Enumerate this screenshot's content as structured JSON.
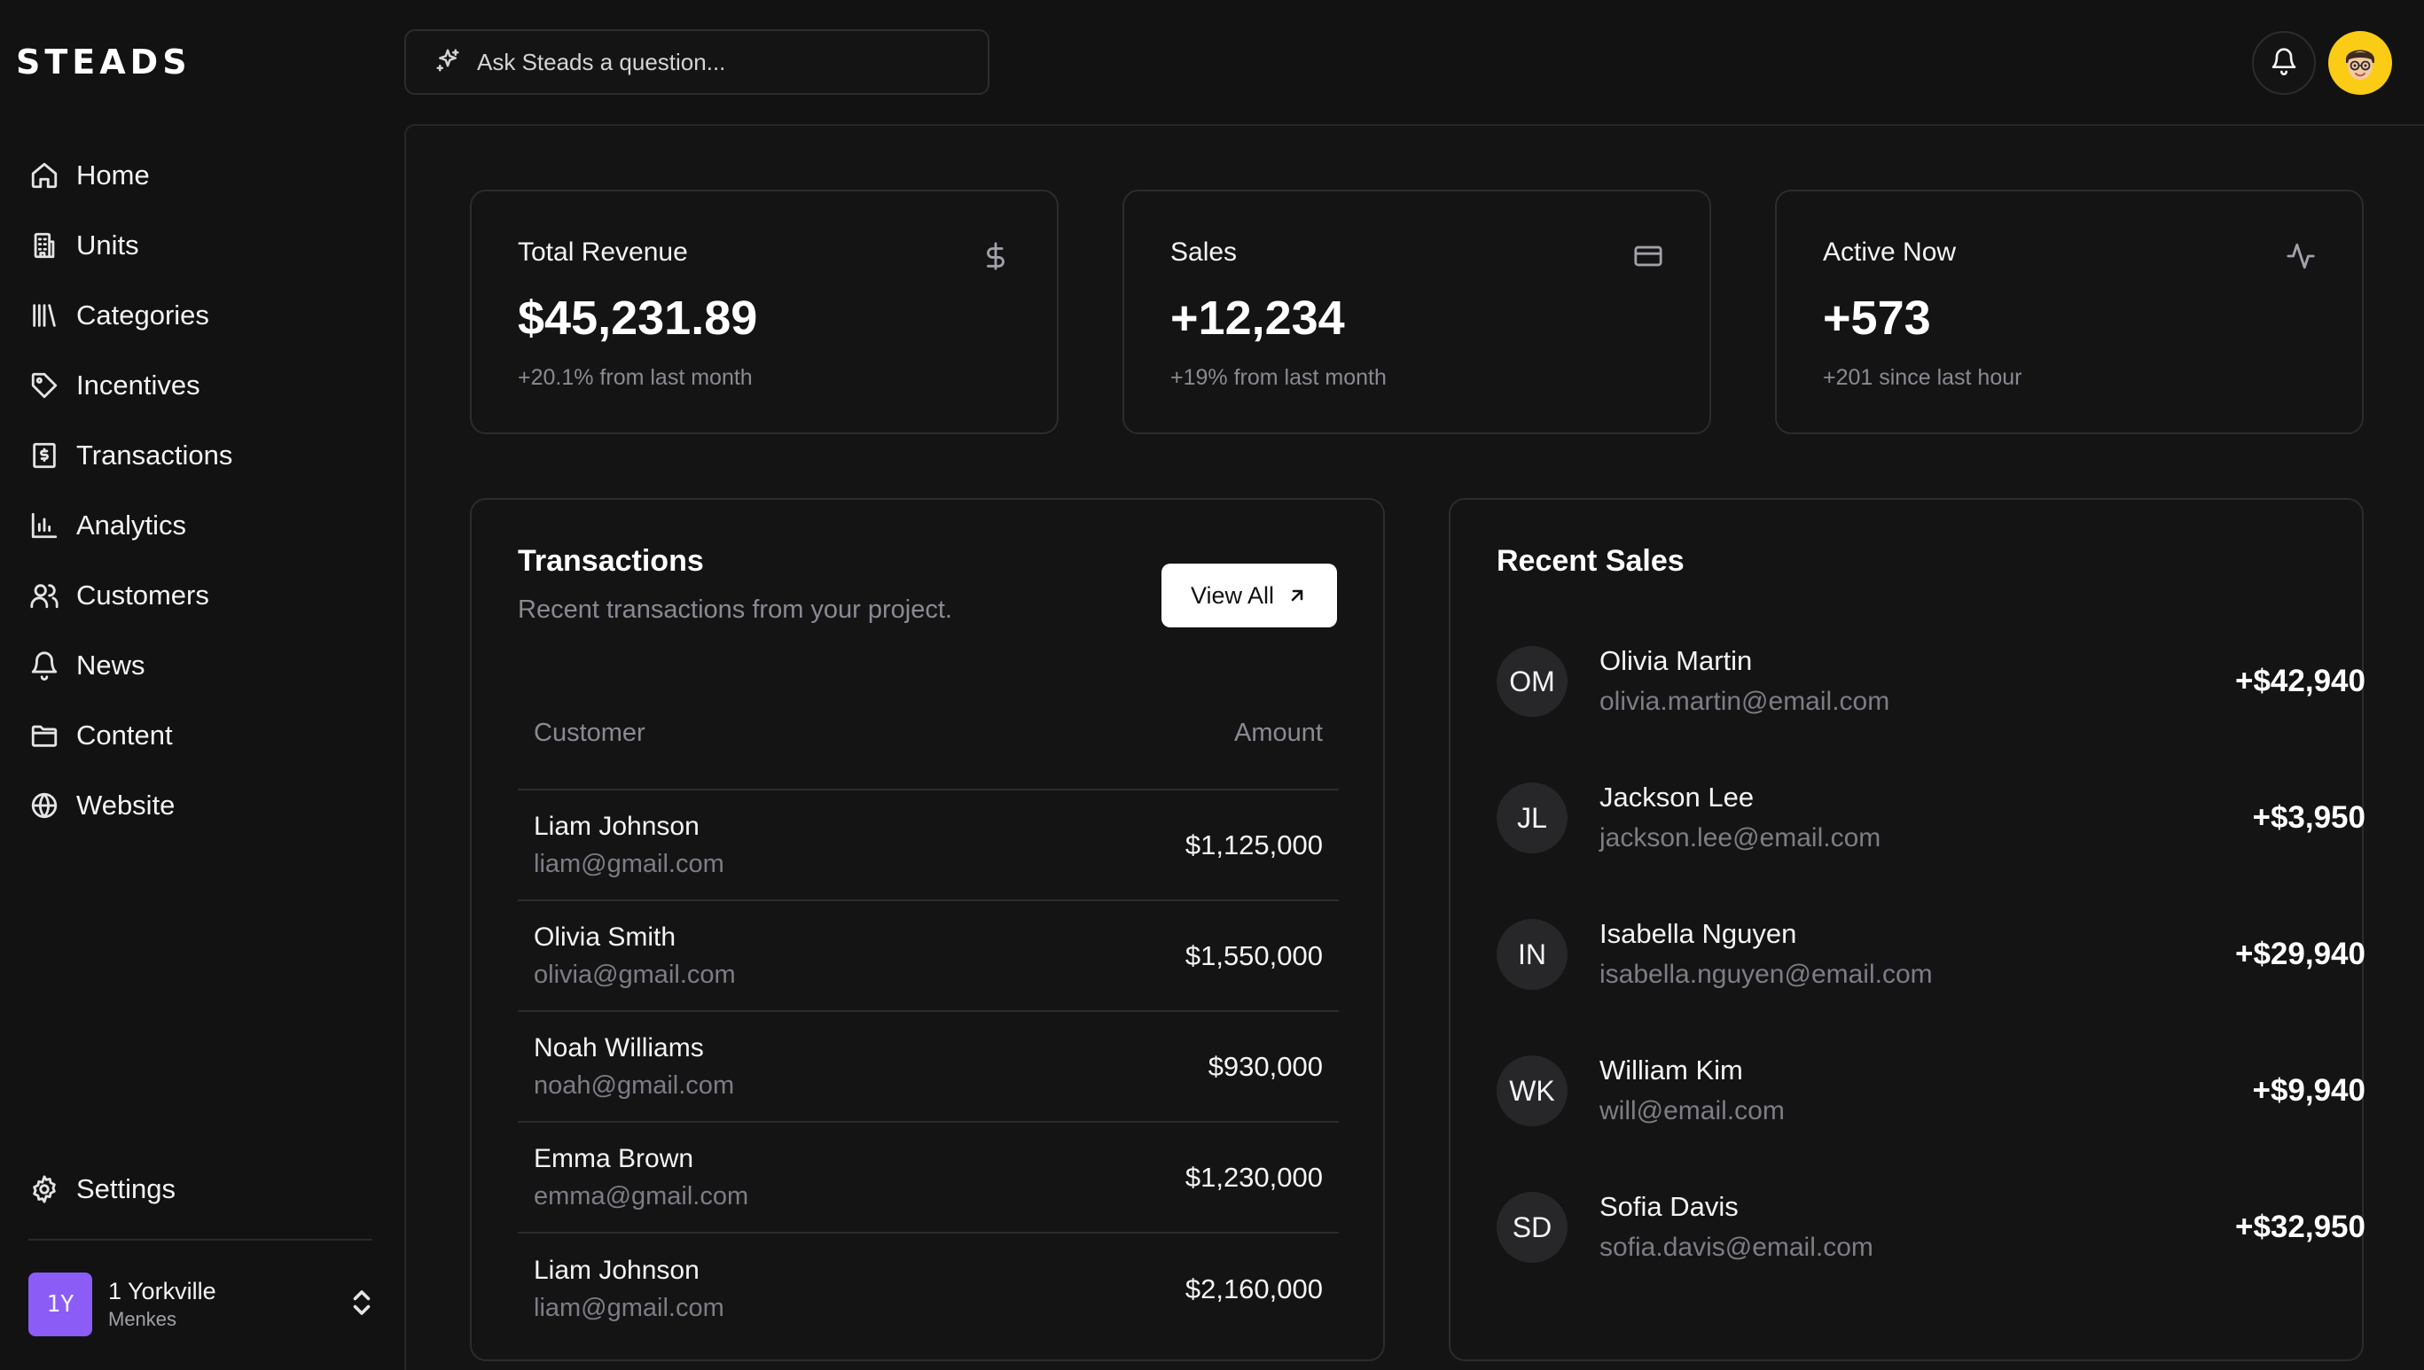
{
  "app": {
    "logo": "STEADS"
  },
  "sidebar": {
    "items": [
      {
        "label": "Home",
        "icon": "home-icon"
      },
      {
        "label": "Units",
        "icon": "building-icon"
      },
      {
        "label": "Categories",
        "icon": "library-icon"
      },
      {
        "label": "Incentives",
        "icon": "tag-icon"
      },
      {
        "label": "Transactions",
        "icon": "receipt-icon"
      },
      {
        "label": "Analytics",
        "icon": "bar-chart-icon"
      },
      {
        "label": "Customers",
        "icon": "users-icon"
      },
      {
        "label": "News",
        "icon": "bell-icon"
      },
      {
        "label": "Content",
        "icon": "folder-icon"
      },
      {
        "label": "Website",
        "icon": "globe-icon"
      }
    ],
    "settings": {
      "label": "Settings",
      "icon": "gear-icon"
    },
    "workspace": {
      "badge": "1Y",
      "name": "1 Yorkville",
      "sub": "Menkes",
      "badge_color": "#8b5cf6"
    }
  },
  "topbar": {
    "search_placeholder": "Ask Steads a question...",
    "avatar_color": "#facc15"
  },
  "stats": [
    {
      "title": "Total Revenue",
      "value": "$45,231.89",
      "sub": "+20.1% from last month",
      "icon": "dollar-icon"
    },
    {
      "title": "Sales",
      "value": "+12,234",
      "sub": "+19% from last month",
      "icon": "credit-card-icon"
    },
    {
      "title": "Active Now",
      "value": "+573",
      "sub": "+201 since last hour",
      "icon": "activity-icon"
    }
  ],
  "transactions": {
    "title": "Transactions",
    "description": "Recent transactions from your project.",
    "view_all": "View All",
    "columns": {
      "customer": "Customer",
      "amount": "Amount"
    },
    "rows": [
      {
        "name": "Liam Johnson",
        "email": "liam@gmail.com",
        "amount": "$1,125,000"
      },
      {
        "name": "Olivia Smith",
        "email": "olivia@gmail.com",
        "amount": "$1,550,000"
      },
      {
        "name": "Noah Williams",
        "email": "noah@gmail.com",
        "amount": "$930,000"
      },
      {
        "name": "Emma Brown",
        "email": "emma@gmail.com",
        "amount": "$1,230,000"
      },
      {
        "name": "Liam Johnson",
        "email": "liam@gmail.com",
        "amount": "$2,160,000"
      }
    ]
  },
  "recent_sales": {
    "title": "Recent Sales",
    "rows": [
      {
        "initials": "OM",
        "name": "Olivia Martin",
        "email": "olivia.martin@email.com",
        "amount": "+$42,940"
      },
      {
        "initials": "JL",
        "name": "Jackson Lee",
        "email": "jackson.lee@email.com",
        "amount": "+$3,950"
      },
      {
        "initials": "IN",
        "name": "Isabella Nguyen",
        "email": "isabella.nguyen@email.com",
        "amount": "+$29,940"
      },
      {
        "initials": "WK",
        "name": "William Kim",
        "email": "will@email.com",
        "amount": "+$9,940"
      },
      {
        "initials": "SD",
        "name": "Sofia Davis",
        "email": "sofia.davis@email.com",
        "amount": "+$32,950"
      }
    ]
  }
}
